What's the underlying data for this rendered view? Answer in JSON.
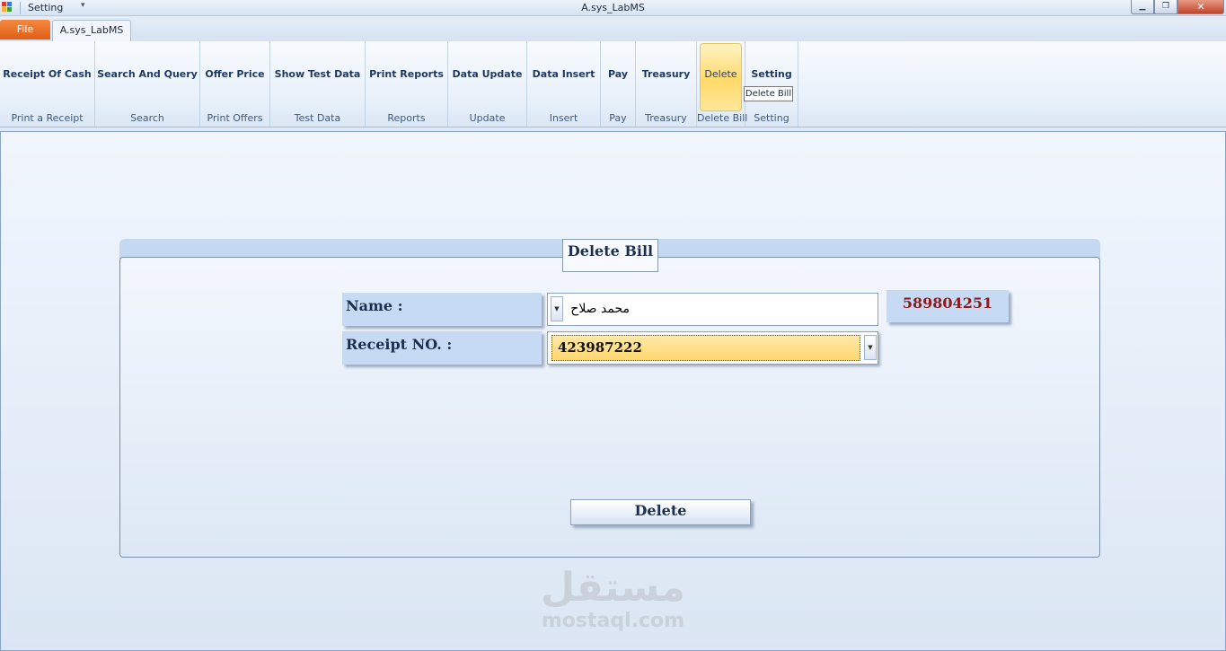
{
  "window": {
    "title": "A.sys_LabMS",
    "quick_access_label": "Setting",
    "controls": {
      "minimize": "▁",
      "maximize": "❐",
      "close": "✕"
    }
  },
  "ribbon": {
    "file_tab": "File",
    "active_tab": "A.sys_LabMS",
    "groups": [
      {
        "button": "Receipt Of Cash",
        "label": "Print a Receipt"
      },
      {
        "button": "Search And Query",
        "label": "Search"
      },
      {
        "button": "Offer Price",
        "label": "Print Offers"
      },
      {
        "button": "Show Test Data",
        "label": "Test Data"
      },
      {
        "button": "Print Reports",
        "label": "Reports"
      },
      {
        "button": "Data Update",
        "label": "Update"
      },
      {
        "button": "Data Insert",
        "label": "Insert"
      },
      {
        "button": "Pay",
        "label": "Pay"
      },
      {
        "button": "Treasury",
        "label": "Treasury"
      },
      {
        "button": "Delete",
        "label": "Delete Bill",
        "active": true
      },
      {
        "button": "Setting",
        "label": "Setting"
      }
    ],
    "tooltip": "Delete Bill"
  },
  "form": {
    "title": "Delete Bill",
    "name_label": "Name :",
    "name_value": "محمد صلاح",
    "receipt_label": "Receipt NO. :",
    "receipt_value": "423987222",
    "id_value": "589804251",
    "delete_button": "Delete"
  },
  "watermark": {
    "arabic": "مستقل",
    "latin": "mostaql.com"
  },
  "colors": {
    "file_tab": "#e96a25",
    "highlight": "#ffd96a",
    "id_text": "#8b1a1a"
  }
}
